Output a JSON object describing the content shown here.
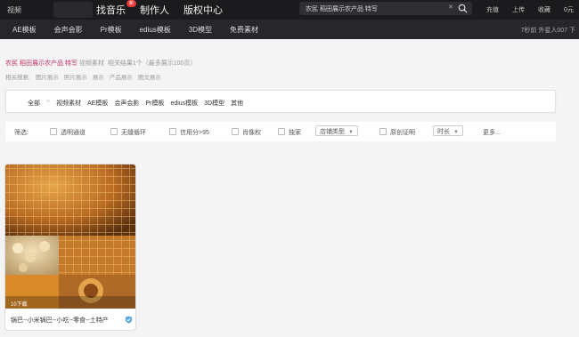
{
  "topbar": {
    "left_link": "视频",
    "nav": [
      {
        "label": "找音乐",
        "badge": "新"
      },
      {
        "label": "制作人"
      },
      {
        "label": "版权中心"
      }
    ],
    "search_query": "农民 稻田展示农产品 特写",
    "links": [
      "充值",
      "上传",
      "收藏",
      "0元"
    ]
  },
  "subbar": {
    "categories": [
      "AE模板",
      "会声会影",
      "Pr模板",
      "edius模板",
      "3D模型",
      "免费素材"
    ],
    "right_text": "7秒前 外星人007 下"
  },
  "result": {
    "query": "农民 稻田展示农产品 特写",
    "type_label": "视频素材",
    "count_text": "相关结果1个（最多展示100页）"
  },
  "related": {
    "label": "相关搜索:",
    "items": [
      "图片展示",
      "照片展示",
      "展示",
      "产品展示",
      "图文展示"
    ]
  },
  "filter_tabs": {
    "items": [
      "全部",
      "视频素材",
      "AE模板",
      "会声会影",
      "Pr模板",
      "edius模板",
      "3D模型",
      "其他"
    ],
    "separator": ">"
  },
  "options": {
    "label": "筛选:",
    "checkboxes": [
      "透明通道",
      "无缝循环",
      "信用分>95",
      "肖像权",
      "独家"
    ],
    "store_select": "店铺类型",
    "original_cert": "原创证明",
    "duration_select": "时长",
    "more": "更多..."
  },
  "cards": [
    {
      "title": "锅巴--小米锅巴--小吃--零食--土特产",
      "downloads": "10下载"
    }
  ],
  "colors": {
    "topbar_bg": "#1b1b1e",
    "subbar_bg": "#26262b",
    "query_accent": "#c3305f",
    "badge_red": "#e53935"
  }
}
